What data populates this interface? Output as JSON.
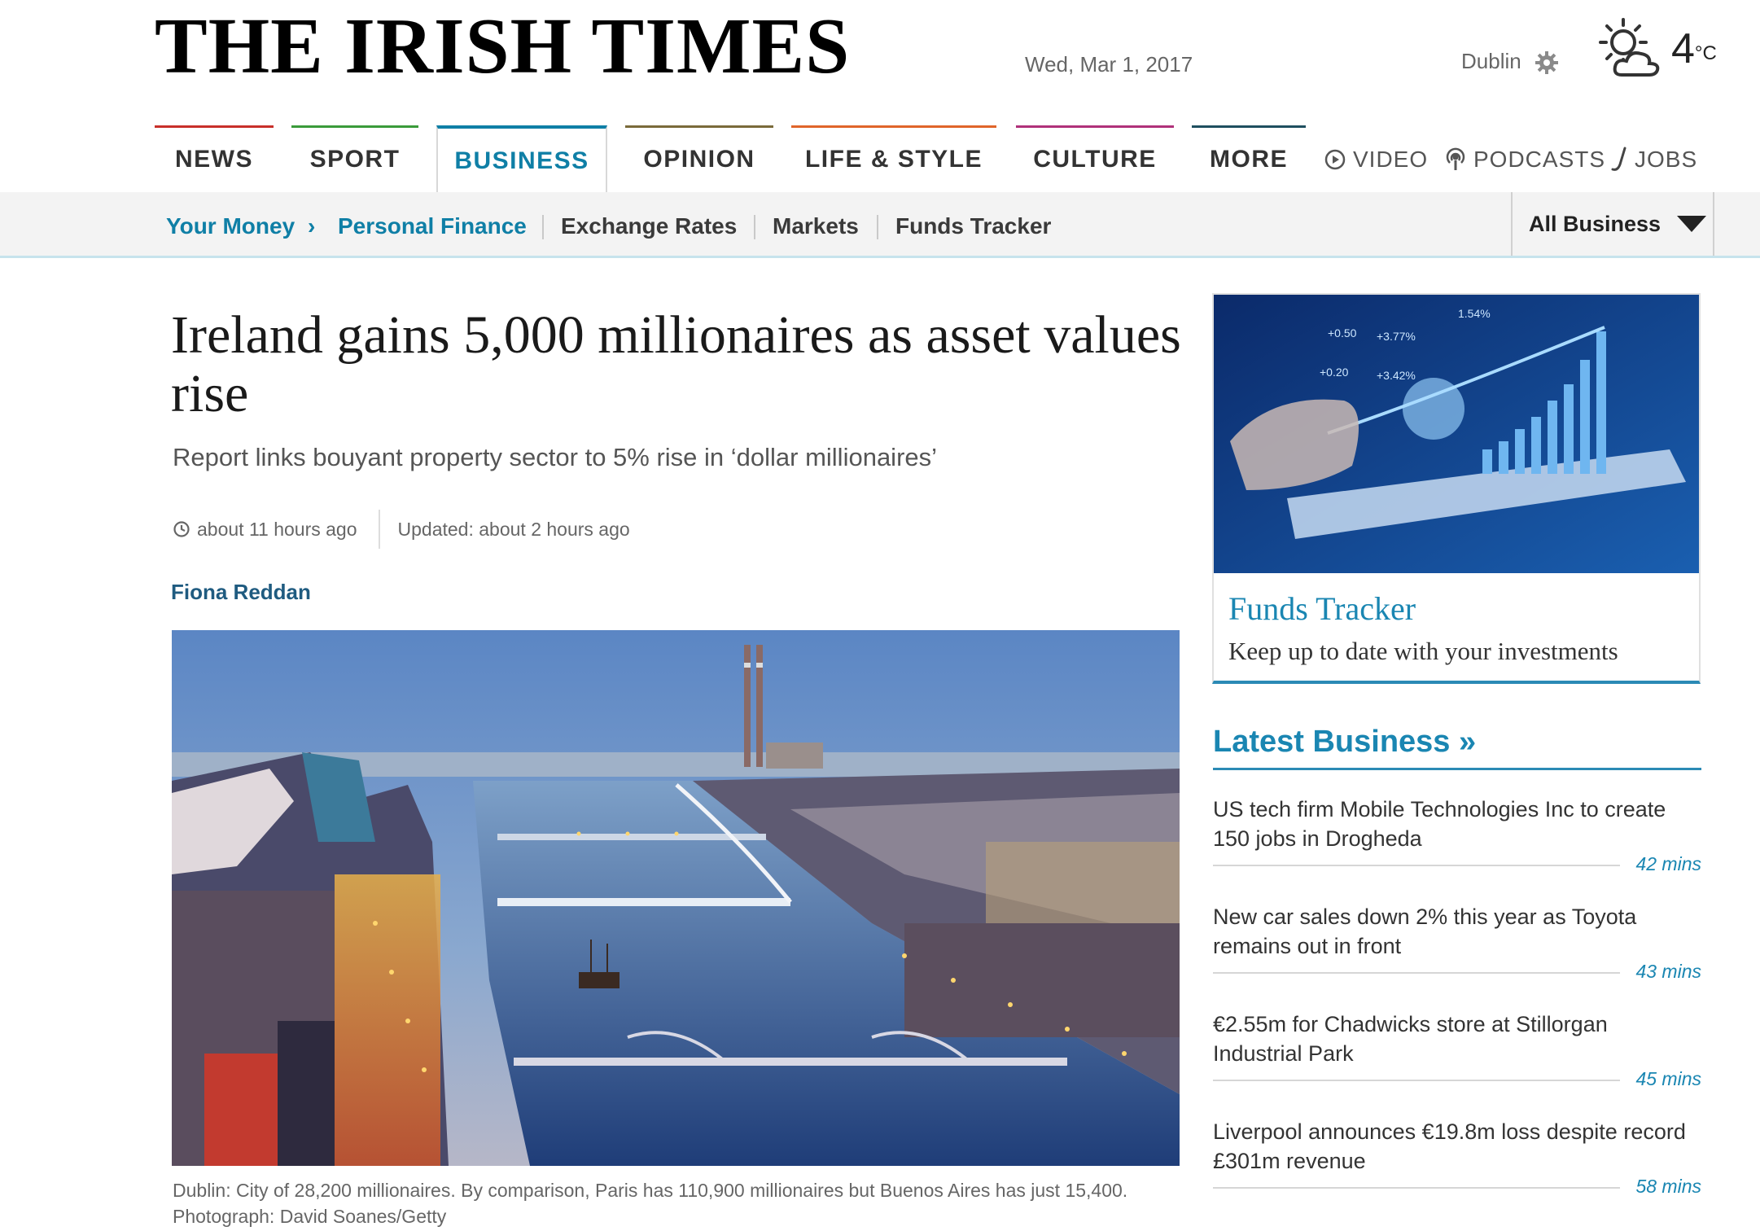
{
  "header": {
    "masthead": "THE IRISH TIMES",
    "date": "Wed, Mar 1, 2017",
    "city": "Dublin",
    "temperature": "4",
    "temperature_unit": "°C"
  },
  "nav": {
    "tabs": [
      {
        "label": "NEWS",
        "color": "#c8302a"
      },
      {
        "label": "SPORT",
        "color": "#3a9b3a"
      },
      {
        "label": "BUSINESS",
        "color": "#0f7fa6"
      },
      {
        "label": "OPINION",
        "color": "#7a6a3a"
      },
      {
        "label": "LIFE & STYLE",
        "color": "#e0652a"
      },
      {
        "label": "CULTURE",
        "color": "#b0317a"
      },
      {
        "label": "MORE",
        "color": "#1f4f5f"
      }
    ],
    "utility": {
      "video": "VIDEO",
      "podcasts": "PODCASTS",
      "jobs": "JOBS"
    }
  },
  "subnav": {
    "breadcrumb_1": "Your Money",
    "breadcrumb_2": "Personal Finance",
    "links": [
      "Exchange Rates",
      "Markets",
      "Funds Tracker"
    ],
    "dropdown": "All Business"
  },
  "article": {
    "headline": "Ireland gains 5,000 millionaires as asset values rise",
    "standfirst": "Report links bouyant property sector to 5% rise in ‘dollar millionaires’",
    "published": "about 11 hours ago",
    "updated": "Updated: about 2 hours ago",
    "author": "Fiona Reddan",
    "caption": "Dublin: City of 28,200 millionaires. By comparison, Paris has 110,900 millionaires but Buenos Aires has just 15,400. Photograph: David Soanes/Getty"
  },
  "promo": {
    "title": "Funds Tracker",
    "description": "Keep up to date with your investments",
    "chart_labels": [
      "1.54%",
      "+0.50",
      "+3.77%",
      "+0.20",
      "+3.42%"
    ]
  },
  "latest": {
    "heading": "Latest Business »",
    "stories": [
      {
        "title": "US tech firm Mobile Technologies Inc to create 150 jobs in Drogheda",
        "time": "42 mins"
      },
      {
        "title": "New car sales down 2% this year as Toyota remains out in front",
        "time": "43 mins"
      },
      {
        "title": "€2.55m for Chadwicks store at Stillorgan Industrial Park",
        "time": "45 mins"
      },
      {
        "title": "Liverpool announces €19.8m loss despite record £301m revenue",
        "time": "58 mins"
      }
    ]
  },
  "colors": {
    "accent": "#0f7fa6",
    "link": "#1a86b2",
    "byline": "#1f5b80"
  }
}
